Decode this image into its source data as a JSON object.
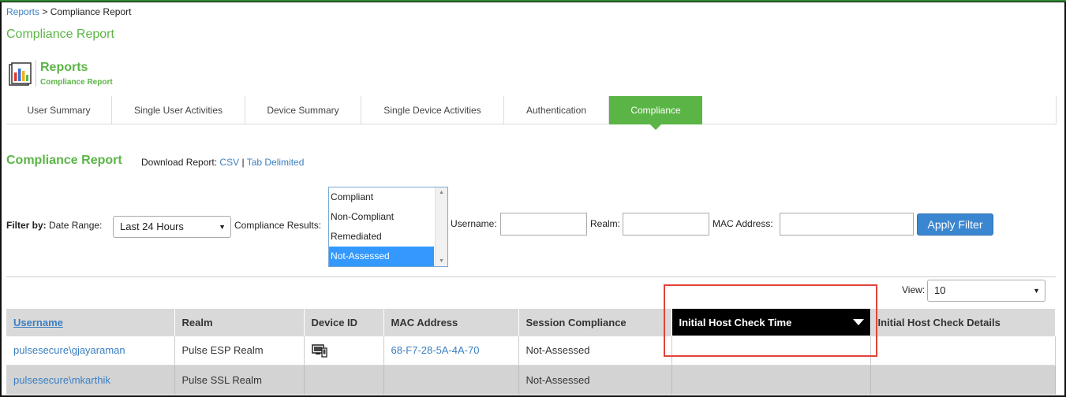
{
  "breadcrumb": {
    "link": "Reports",
    "separator": " > ",
    "current": "Compliance Report"
  },
  "page_heading": "Compliance Report",
  "header": {
    "title": "Reports",
    "subtitle": "Compliance Report",
    "icon": "reports-chart-icon"
  },
  "tabs": [
    {
      "label": "User Summary"
    },
    {
      "label": "Single User Activities"
    },
    {
      "label": "Device Summary"
    },
    {
      "label": "Single Device Activities"
    },
    {
      "label": "Authentication"
    },
    {
      "label": "Compliance",
      "active": true
    }
  ],
  "section": {
    "title": "Compliance Report",
    "download_label": "Download Report:",
    "csv_link": "CSV",
    "separator": "|",
    "tab_link": "Tab Delimited"
  },
  "filter": {
    "filter_by": "Filter by:",
    "date_range_label": "Date Range:",
    "date_range_value": "Last 24 Hours",
    "results_label": "Compliance Results:",
    "results_options": [
      "Compliant",
      "Non-Compliant",
      "Remediated",
      "Not-Assessed"
    ],
    "results_selected": "Not-Assessed",
    "username_label": "Username:",
    "username_value": "",
    "realm_label": "Realm:",
    "realm_value": "",
    "mac_label": "MAC Address:",
    "mac_value": "",
    "apply_label": "Apply Filter"
  },
  "view": {
    "label": "View:",
    "value": "10"
  },
  "table": {
    "columns": [
      "Username",
      "Realm",
      "Device ID",
      "MAC Address",
      "Session Compliance",
      "Initial Host Check Time",
      "Initial Host Check Details"
    ],
    "rows": [
      {
        "username": "pulsesecure\\gjayaraman",
        "realm": "Pulse ESP Realm",
        "device_icon": "device-icon",
        "mac": "68-F7-28-5A-4A-70",
        "session_compliance": "Not-Assessed",
        "check_time": "",
        "check_details": ""
      },
      {
        "username": "pulsesecure\\mkarthik",
        "realm": "Pulse SSL Realm",
        "device_icon": "",
        "mac": "",
        "session_compliance": "Not-Assessed",
        "check_time": "",
        "check_details": ""
      }
    ]
  },
  "colors": {
    "brand_green": "#5bb546",
    "link_blue": "#3a7fc1",
    "button_blue": "#3b86d0",
    "highlight_red": "#e0443a"
  }
}
